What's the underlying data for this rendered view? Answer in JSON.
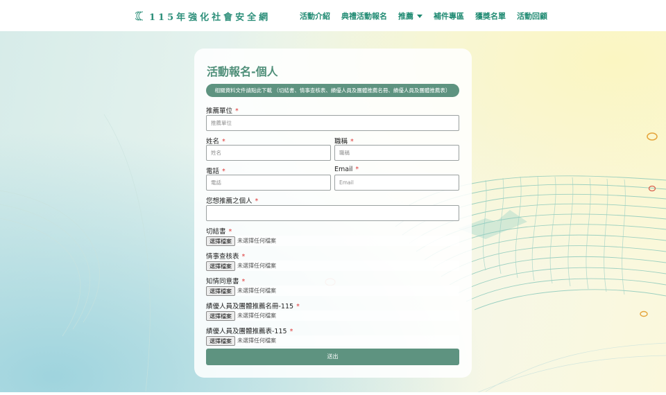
{
  "header": {
    "logo_text": "115年強化社會安全網",
    "nav": [
      {
        "label": "活動介紹"
      },
      {
        "label": "典禮活動報名"
      },
      {
        "label": "推薦"
      },
      {
        "label": "補件專區"
      },
      {
        "label": "獲獎名單"
      },
      {
        "label": "活動回顧"
      }
    ]
  },
  "form": {
    "title": "活動報名-個人",
    "notice": "相關資料文件請點此下載 （切結書、情事查核表、績優人員及團體推薦名冊、績優人員及團體推薦表）",
    "required_mark": "*",
    "fields": {
      "unit": {
        "label": "推薦單位",
        "placeholder": "推薦單位"
      },
      "name": {
        "label": "姓名",
        "placeholder": "姓名"
      },
      "title": {
        "label": "職稱",
        "placeholder": "職稱"
      },
      "phone": {
        "label": "電話",
        "placeholder": "電話"
      },
      "email": {
        "label": "Email",
        "placeholder": "Email"
      },
      "person": {
        "label": "您想推薦之個人",
        "placeholder": ""
      }
    },
    "files": [
      {
        "label": "切結書",
        "button": "選擇檔案",
        "status": "未選擇任何檔案"
      },
      {
        "label": "情事查核表",
        "button": "選擇檔案",
        "status": "未選擇任何檔案"
      },
      {
        "label": "知情同意書",
        "button": "選擇檔案",
        "status": "未選擇任何檔案"
      },
      {
        "label": "績優人員及團體推薦名冊-115",
        "button": "選擇檔案",
        "status": "未選擇任何檔案"
      },
      {
        "label": "績優人員及團體推薦表-115",
        "button": "選擇檔案",
        "status": "未選擇任何檔案"
      }
    ],
    "submit_label": "送出"
  },
  "colors": {
    "brand": "#1f8a72",
    "accent": "#5e9380",
    "required": "#dd3333",
    "ring": "#e5a53c"
  }
}
